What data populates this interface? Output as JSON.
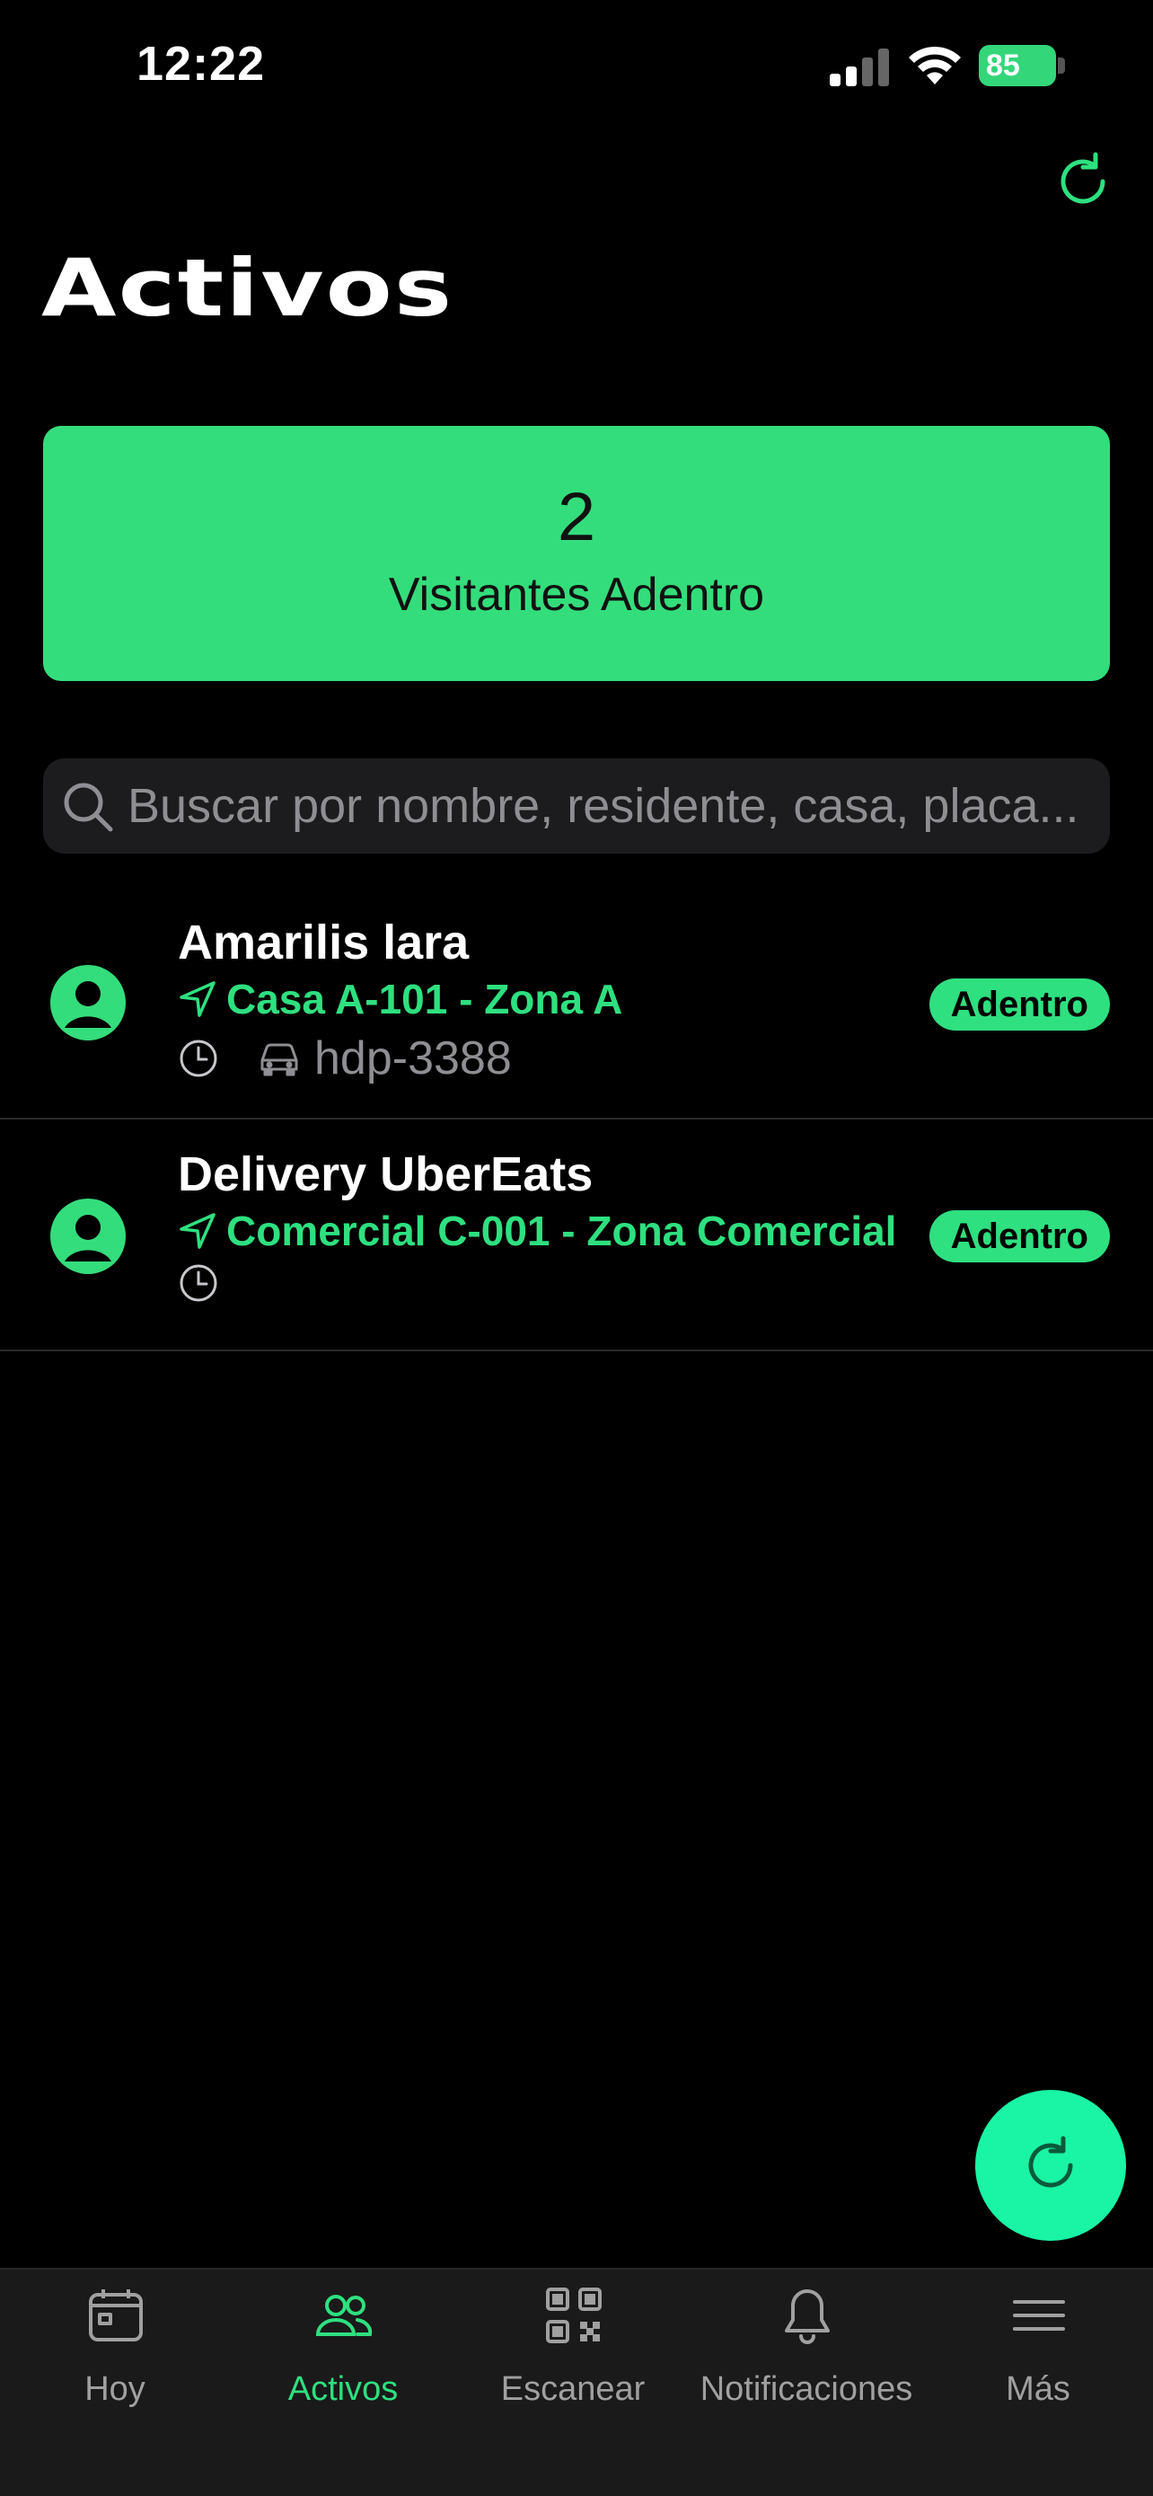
{
  "status_bar": {
    "time": "12:22",
    "battery": "85"
  },
  "header": {
    "title": "Activos",
    "refresh_icon": "refresh-icon"
  },
  "summary": {
    "count": "2",
    "label": "Visitantes Adentro"
  },
  "search": {
    "placeholder": "Buscar por nombre, residente, casa, placa..."
  },
  "visitors": [
    {
      "name": "Amarilis lara",
      "location": "Casa A-101 - Zona A",
      "plate": "hdp-3388",
      "status": "Adentro"
    },
    {
      "name": "Delivery UberEats",
      "location": "Comercial C-001 - Zona Comercial",
      "plate": "",
      "status": "Adentro"
    }
  ],
  "tabs": [
    {
      "label": "Hoy",
      "icon": "calendar-icon",
      "active": false
    },
    {
      "label": "Activos",
      "icon": "users-icon",
      "active": true
    },
    {
      "label": "Escanear",
      "icon": "qr-code-icon",
      "active": false
    },
    {
      "label": "Notificaciones",
      "icon": "bell-icon",
      "active": false
    },
    {
      "label": "Más",
      "icon": "menu-icon",
      "active": false
    }
  ],
  "colors": {
    "accent": "#2ee07f",
    "card": "#34dd7b",
    "fab": "#19f5a4",
    "background": "#000000"
  }
}
